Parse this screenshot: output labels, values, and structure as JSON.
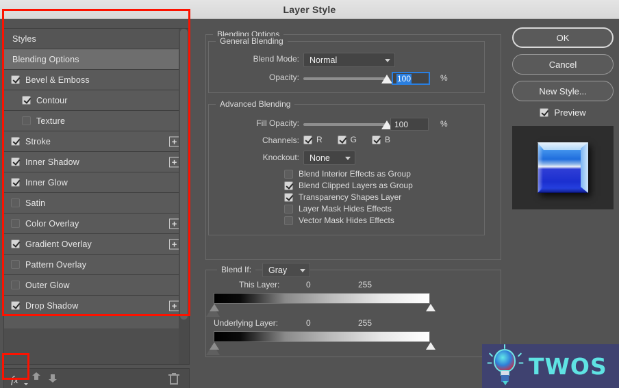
{
  "window": {
    "title": "Layer Style"
  },
  "sidebar": {
    "items": [
      {
        "label": "Styles",
        "checkbox": "none",
        "sub": false,
        "plus": false,
        "selected": false
      },
      {
        "label": "Blending Options",
        "checkbox": "none",
        "sub": false,
        "plus": false,
        "selected": true
      },
      {
        "label": "Bevel & Emboss",
        "checkbox": "checked",
        "sub": false,
        "plus": false,
        "selected": false
      },
      {
        "label": "Contour",
        "checkbox": "checked",
        "sub": true,
        "plus": false,
        "selected": false
      },
      {
        "label": "Texture",
        "checkbox": "unchecked",
        "sub": true,
        "plus": false,
        "selected": false
      },
      {
        "label": "Stroke",
        "checkbox": "checked",
        "sub": false,
        "plus": true,
        "selected": false
      },
      {
        "label": "Inner Shadow",
        "checkbox": "checked",
        "sub": false,
        "plus": true,
        "selected": false
      },
      {
        "label": "Inner Glow",
        "checkbox": "checked",
        "sub": false,
        "plus": false,
        "selected": false
      },
      {
        "label": "Satin",
        "checkbox": "unchecked",
        "sub": false,
        "plus": false,
        "selected": false
      },
      {
        "label": "Color Overlay",
        "checkbox": "unchecked",
        "sub": false,
        "plus": true,
        "selected": false
      },
      {
        "label": "Gradient Overlay",
        "checkbox": "checked",
        "sub": false,
        "plus": true,
        "selected": false
      },
      {
        "label": "Pattern Overlay",
        "checkbox": "unchecked",
        "sub": false,
        "plus": false,
        "selected": false
      },
      {
        "label": "Outer Glow",
        "checkbox": "unchecked",
        "sub": false,
        "plus": false,
        "selected": false
      },
      {
        "label": "Drop Shadow",
        "checkbox": "checked",
        "sub": false,
        "plus": true,
        "selected": false
      }
    ],
    "toolbar": {
      "fx_label": "fx",
      "move_up_label": "Move effect up",
      "move_down_label": "Move effect down",
      "delete_label": "Delete effect"
    },
    "plus_glyph": "+"
  },
  "main": {
    "blending_options_legend": "Blending Options",
    "general_blending": {
      "legend": "General Blending",
      "blend_mode_label": "Blend Mode:",
      "blend_mode_value": "Normal",
      "opacity_label": "Opacity:",
      "opacity_value": "100",
      "opacity_unit": "%",
      "opacity_percent": 100
    },
    "advanced_blending": {
      "legend": "Advanced Blending",
      "fill_opacity_label": "Fill Opacity:",
      "fill_opacity_value": "100",
      "fill_opacity_unit": "%",
      "fill_opacity_percent": 100,
      "channels_label": "Channels:",
      "channels": [
        {
          "label": "R",
          "checked": true
        },
        {
          "label": "G",
          "checked": true
        },
        {
          "label": "B",
          "checked": true
        }
      ],
      "knockout_label": "Knockout:",
      "knockout_value": "None",
      "options": [
        {
          "label": "Blend Interior Effects as Group",
          "checked": false
        },
        {
          "label": "Blend Clipped Layers as Group",
          "checked": true
        },
        {
          "label": "Transparency Shapes Layer",
          "checked": true
        },
        {
          "label": "Layer Mask Hides Effects",
          "checked": false
        },
        {
          "label": "Vector Mask Hides Effects",
          "checked": false
        }
      ]
    },
    "blend_if": {
      "legend": "Blend If:",
      "channel_value": "Gray",
      "this_layer": {
        "label": "This Layer:",
        "min": "0",
        "max": "255"
      },
      "underlying_layer": {
        "label": "Underlying Layer:",
        "min": "0",
        "max": "255"
      }
    }
  },
  "buttons": {
    "ok": "OK",
    "cancel": "Cancel",
    "new_style": "New Style...",
    "preview_label": "Preview",
    "preview_checked": true
  },
  "watermark": {
    "text": "TWOS"
  },
  "colors": {
    "dialog_bg": "#535353",
    "row_bg": "#5a5a5a",
    "row_selected_bg": "#6e6e6e",
    "accent_selection": "#2a7fe0",
    "annotation_red": "#fc1200",
    "watermark_bg": "#3f4270",
    "watermark_text": "#5fe3e3",
    "desktop_blue": "#7e95b0"
  }
}
